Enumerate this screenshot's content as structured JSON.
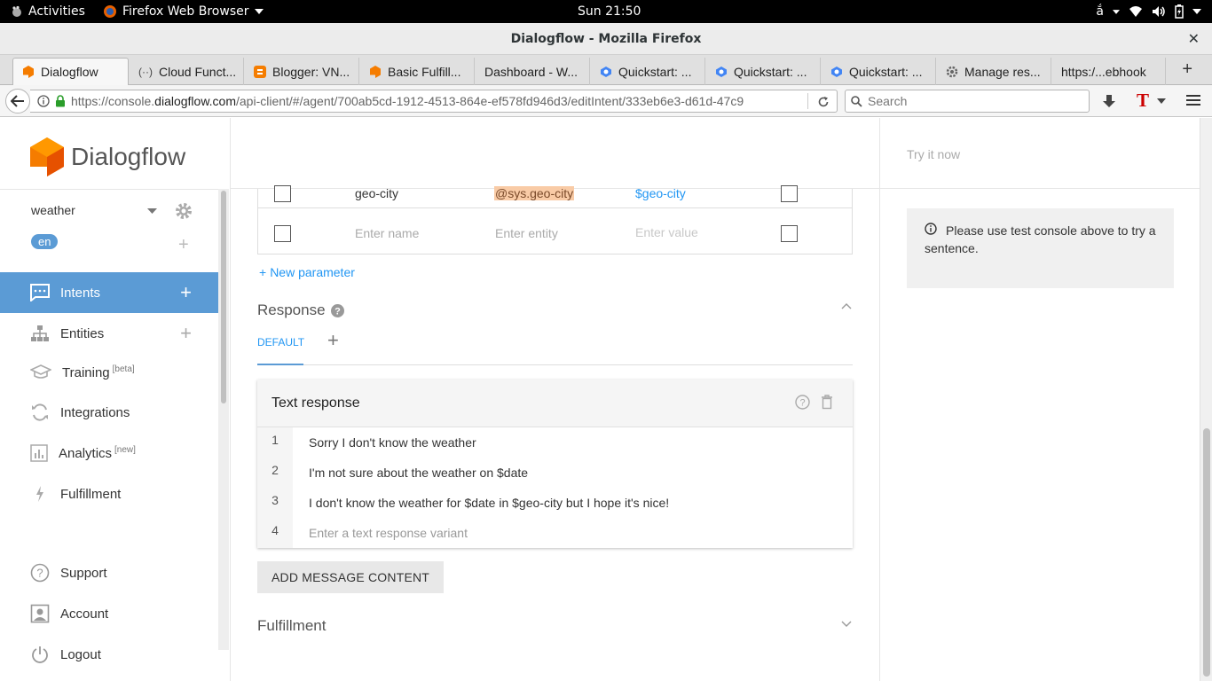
{
  "system_bar": {
    "activities": "Activities",
    "app_name": "Firefox Web Browser",
    "clock": "Sun 21:50",
    "input_method": "ắ"
  },
  "window": {
    "title": "Dialogflow - Mozilla Firefox"
  },
  "tabs": [
    {
      "label": "Dialogflow",
      "icon": "dialogflow-icon"
    },
    {
      "label": "Cloud Funct...",
      "icon": "code-icon"
    },
    {
      "label": "Blogger: VN...",
      "icon": "blogger-icon"
    },
    {
      "label": "Basic Fulfill...",
      "icon": "dialogflow-icon"
    },
    {
      "label": "Dashboard - W...",
      "icon": ""
    },
    {
      "label": "Quickstart: ...",
      "icon": "google-cloud-icon"
    },
    {
      "label": "Quickstart: ...",
      "icon": "google-cloud-icon"
    },
    {
      "label": "Quickstart: ...",
      "icon": "google-cloud-icon"
    },
    {
      "label": "Manage res...",
      "icon": "gear-icon"
    },
    {
      "label": "https:/...ebhook",
      "icon": ""
    }
  ],
  "navbar": {
    "url_prefix": "https://console.",
    "url_domain": "dialogflow.com",
    "url_rest": "/api-client/#/agent/700ab5cd-1912-4513-864e-ef578fd946d3/editIntent/333eb6e3-d61d-47c9",
    "search_placeholder": "Search"
  },
  "sidebar": {
    "brand": "Dialogflow",
    "agent": "weather",
    "language": "en",
    "items": [
      {
        "label": "Intents",
        "sup": ""
      },
      {
        "label": "Entities",
        "sup": ""
      },
      {
        "label": "Training",
        "sup": "[beta]"
      },
      {
        "label": "Integrations",
        "sup": ""
      },
      {
        "label": "Analytics",
        "sup": "[new]"
      },
      {
        "label": "Fulfillment",
        "sup": ""
      },
      {
        "label": "Support",
        "sup": ""
      },
      {
        "label": "Account",
        "sup": ""
      },
      {
        "label": "Logout",
        "sup": ""
      }
    ]
  },
  "parameters": {
    "rows": [
      {
        "name": "geo-city",
        "entity": "@sys.geo-city",
        "value": "$geo-city"
      }
    ],
    "placeholders": {
      "name": "Enter name",
      "entity": "Enter entity",
      "value": "Enter value"
    },
    "new_parameter": "New parameter"
  },
  "response": {
    "title": "Response",
    "tab_default": "DEFAULT",
    "card_title": "Text response",
    "variants": [
      {
        "num": "1",
        "text": "Sorry I don't know the weather"
      },
      {
        "num": "2",
        "text": "I'm not sure about the weather on $date"
      },
      {
        "num": "3",
        "text": "I don't know the weather for $date in $geo-city but I hope it's nice!"
      }
    ],
    "placeholder_num": "4",
    "placeholder": "Enter a text response variant",
    "add_message": "ADD MESSAGE CONTENT"
  },
  "fulfillment": {
    "title": "Fulfillment"
  },
  "try_panel": {
    "try_it_now": "Try it now",
    "info": "Please use test console above to try a sentence."
  },
  "colors": {
    "accent": "#5b9bd5",
    "link": "#2196f3",
    "entity_highlight": "#f9cba6",
    "dialogflow_orange": "#f57c00"
  }
}
